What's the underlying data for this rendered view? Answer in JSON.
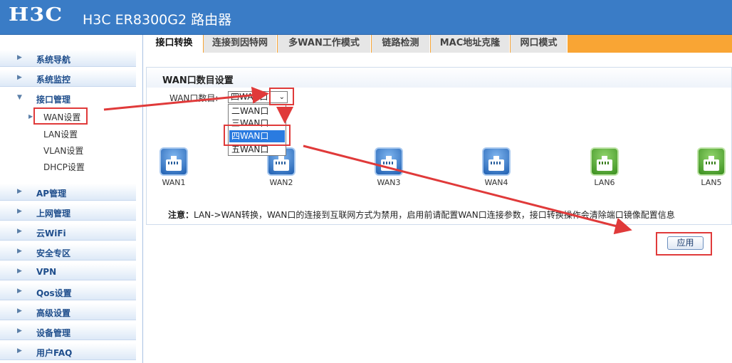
{
  "header": {
    "logo": "H3C",
    "title": "H3C ER8300G2 路由器"
  },
  "sidebar": {
    "items": [
      {
        "label": "系统导航"
      },
      {
        "label": "系统监控"
      },
      {
        "label": "接口管理"
      },
      {
        "label": "AP管理"
      },
      {
        "label": "上网管理"
      },
      {
        "label": "云WiFi"
      },
      {
        "label": "安全专区"
      },
      {
        "label": "VPN"
      },
      {
        "label": "Qos设置"
      },
      {
        "label": "高级设置"
      },
      {
        "label": "设备管理"
      },
      {
        "label": "用户FAQ"
      }
    ],
    "sub_items": [
      {
        "label": "WAN设置"
      },
      {
        "label": "LAN设置"
      },
      {
        "label": "VLAN设置"
      },
      {
        "label": "DHCP设置"
      }
    ]
  },
  "tabs": [
    {
      "label": "接口转换"
    },
    {
      "label": "连接到因特网"
    },
    {
      "label": "多WAN工作模式"
    },
    {
      "label": "链路检测"
    },
    {
      "label": "MAC地址克隆"
    },
    {
      "label": "网口模式"
    }
  ],
  "panel": {
    "title": "WAN口数目设置",
    "wan_count_label": "WAN口数目:",
    "wan_count_value": "四WAN口",
    "options": [
      "二WAN口",
      "三WAN口",
      "四WAN口",
      "五WAN口"
    ],
    "ports": [
      {
        "name": "WAN1",
        "type": "wan"
      },
      {
        "name": "WAN2",
        "type": "wan"
      },
      {
        "name": "WAN3",
        "type": "wan"
      },
      {
        "name": "WAN4",
        "type": "wan"
      },
      {
        "name": "LAN6",
        "type": "lan"
      },
      {
        "name": "LAN5",
        "type": "lan"
      }
    ],
    "note_prefix": "注意：",
    "note_text": "LAN->WAN转换，WAN口的连接到互联网方式为禁用，启用前请配置WAN口连接参数，接口转换操作会清除端口镜像配置信息"
  },
  "apply_label": "应用",
  "colors": {
    "header_bg": "#3a7cc6",
    "tab_accent": "#f9a534",
    "selected_option": "#2a7be0",
    "annotation_red": "#e03a3a"
  }
}
